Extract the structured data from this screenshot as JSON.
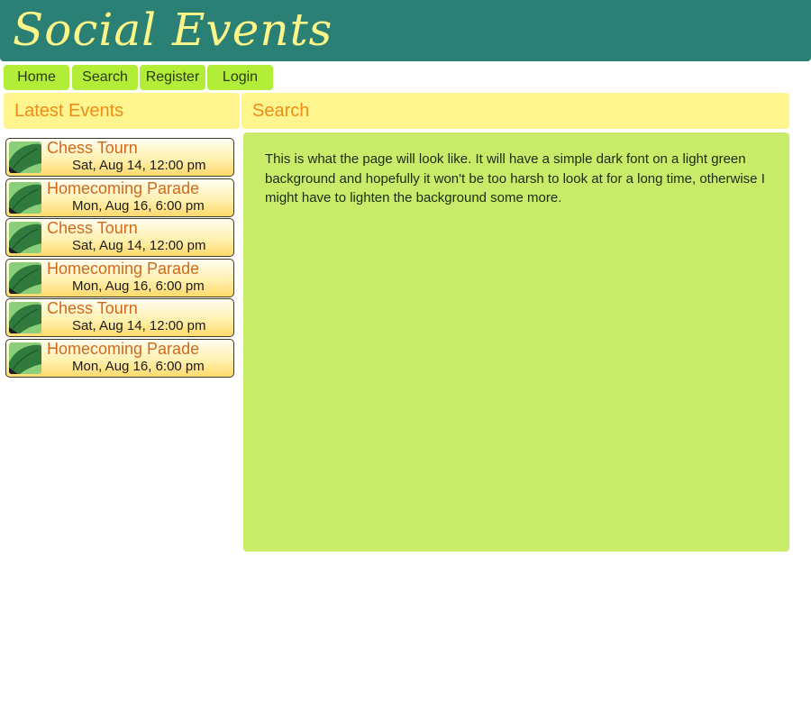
{
  "header": {
    "title": "Social Events"
  },
  "nav": {
    "items": [
      {
        "label": "Home"
      },
      {
        "label": "Search"
      },
      {
        "label": "Register"
      },
      {
        "label": "Login"
      }
    ]
  },
  "sidebar": {
    "title": "Latest Events",
    "events": [
      {
        "name": "Chess Tourn",
        "date": "Sat, Aug 14, 12:00 pm"
      },
      {
        "name": "Homecoming Parade",
        "date": "Mon, Aug 16, 6:00 pm"
      },
      {
        "name": "Chess Tourn",
        "date": "Sat, Aug 14, 12:00 pm"
      },
      {
        "name": "Homecoming Parade",
        "date": "Mon, Aug 16, 6:00 pm"
      },
      {
        "name": "Chess Tourn",
        "date": "Sat, Aug 14, 12:00 pm"
      },
      {
        "name": "Homecoming Parade",
        "date": "Mon, Aug 16, 6:00 pm"
      }
    ]
  },
  "main": {
    "title": "Search",
    "body": "This is what the page will look like. It will have a simple dark font on a light green background and hopefully it won't be too harsh to look at for a long time, otherwise I might have to lighten the background some more."
  },
  "colors": {
    "header_bg": "#2a8074",
    "title_text": "#fbf58a",
    "nav_button": "#b2ed38",
    "panel_title_bg": "#fff58f",
    "panel_title_text": "#f18a16",
    "content_bg": "#c8ec6a",
    "event_name": "#cf6a1d"
  },
  "icons": {
    "event": "event-leaf-icon"
  }
}
